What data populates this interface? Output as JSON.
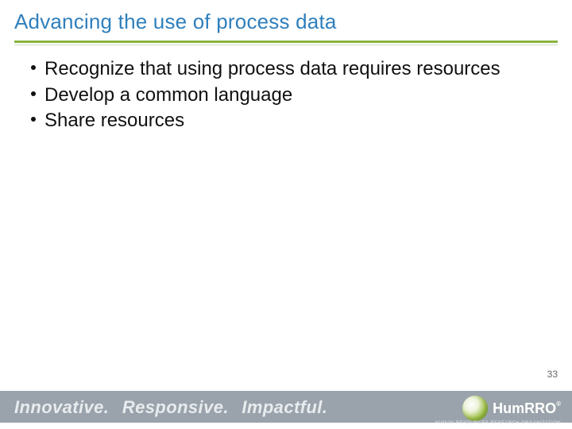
{
  "title": {
    "text": "Advancing the use of process data",
    "color": "#2f7fbc"
  },
  "bullets": [
    "Recognize that using process data requires resources",
    "Develop a common language",
    "Share resources"
  ],
  "page_number": "33",
  "footer": {
    "tagline": [
      "Innovative.",
      "Responsive.",
      "Impactful."
    ],
    "band_color": "#9aa3ab",
    "logo": {
      "text_primary": "Hum",
      "text_secondary": "RRO",
      "subtext": "HUMAN RESOURCES RESEARCH ORGANIZATION"
    }
  },
  "accent": {
    "rule_color": "#8bb43f"
  }
}
